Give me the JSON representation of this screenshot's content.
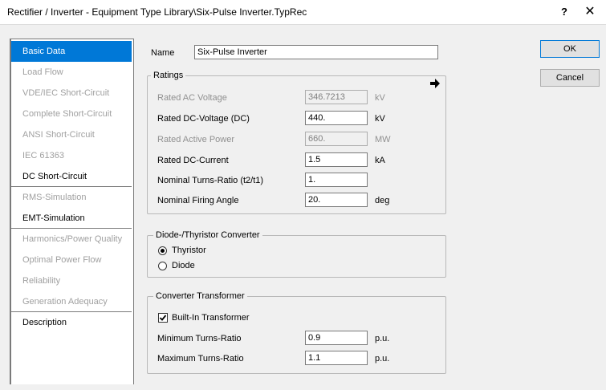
{
  "window": {
    "title": "Rectifier / Inverter - Equipment Type Library\\Six-Pulse Inverter.TypRec",
    "help_label": "?",
    "close_label": "✕"
  },
  "nav": {
    "items": [
      {
        "label": "Basic Data"
      },
      {
        "label": "Load Flow"
      },
      {
        "label": "VDE/IEC Short-Circuit"
      },
      {
        "label": "Complete Short-Circuit"
      },
      {
        "label": "ANSI Short-Circuit"
      },
      {
        "label": "IEC 61363"
      },
      {
        "label": "DC Short-Circuit"
      },
      {
        "label": "RMS-Simulation"
      },
      {
        "label": "EMT-Simulation"
      },
      {
        "label": "Harmonics/Power Quality"
      },
      {
        "label": "Optimal Power Flow"
      },
      {
        "label": "Reliability"
      },
      {
        "label": "Generation Adequacy"
      },
      {
        "label": "Description"
      }
    ]
  },
  "name": {
    "label": "Name",
    "value": "Six-Pulse Inverter"
  },
  "ratings": {
    "title": "Ratings",
    "ac_voltage": {
      "label": "Rated AC Voltage",
      "value": "346.7213",
      "unit": "kV"
    },
    "dc_voltage": {
      "label": "Rated DC-Voltage (DC)",
      "value": "440.",
      "unit": "kV"
    },
    "active_power": {
      "label": "Rated Active Power",
      "value": "660.",
      "unit": "MW"
    },
    "dc_current": {
      "label": "Rated DC-Current",
      "value": "1.5",
      "unit": "kA"
    },
    "turns_ratio": {
      "label": "Nominal Turns-Ratio (t2/t1)",
      "value": "1."
    },
    "firing_angle": {
      "label": "Nominal Firing Angle",
      "value": "20.",
      "unit": "deg"
    }
  },
  "converter": {
    "title": "Diode-/Thyristor Converter",
    "thyristor_label": "Thyristor",
    "diode_label": "Diode",
    "selected": "Thyristor"
  },
  "transformer": {
    "title": "Converter Transformer",
    "builtin_label": "Built-In Transformer",
    "builtin_checked": true,
    "min_ratio": {
      "label": "Minimum Turns-Ratio",
      "value": "0.9",
      "unit": "p.u."
    },
    "max_ratio": {
      "label": "Maximum Turns-Ratio",
      "value": "1.1",
      "unit": "p.u."
    }
  },
  "buttons": {
    "ok": "OK",
    "cancel": "Cancel"
  }
}
